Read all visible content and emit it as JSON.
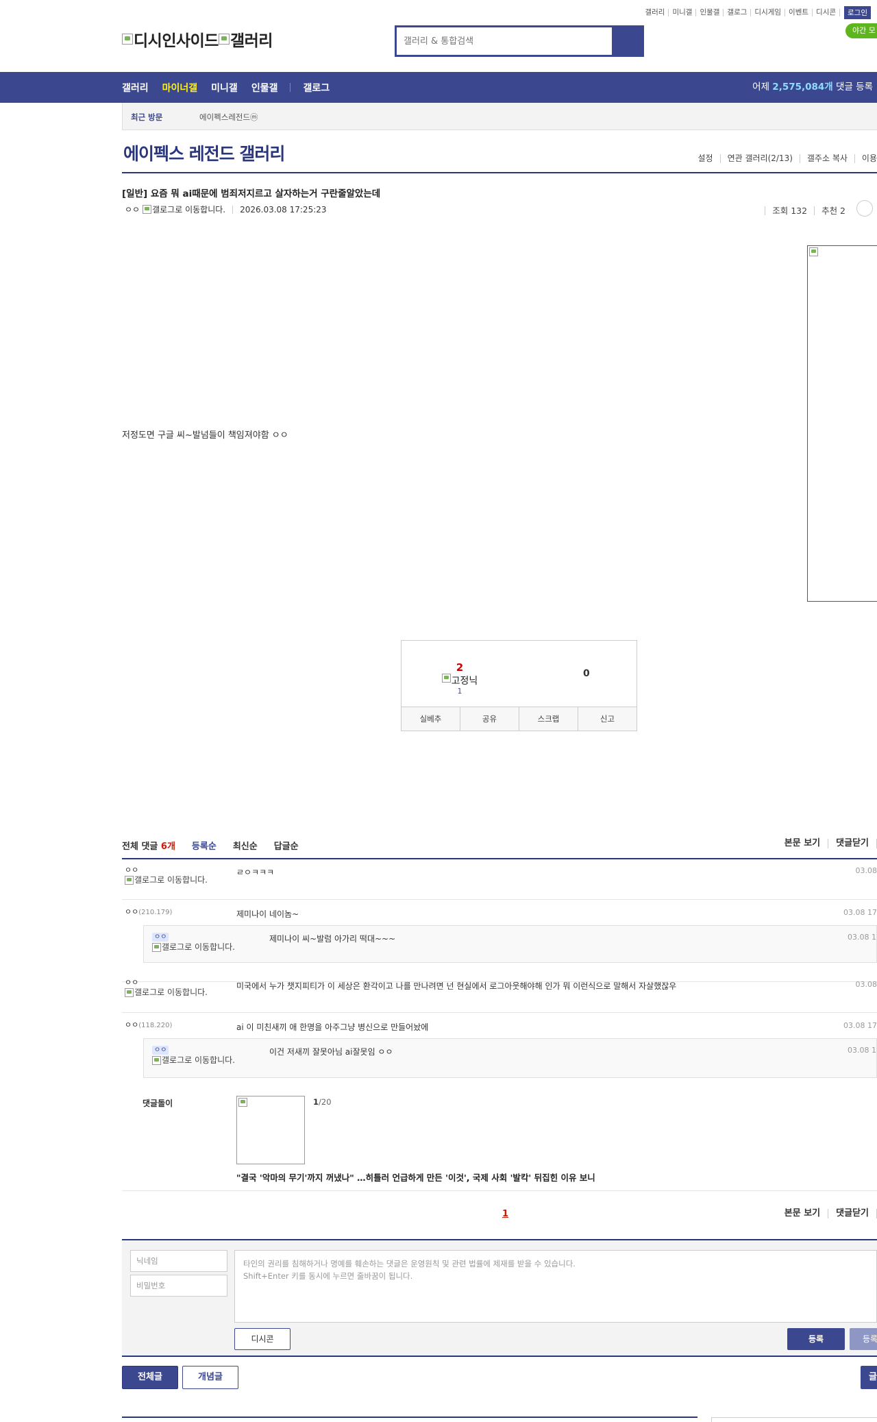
{
  "util_links": [
    "갤러리",
    "미니갤",
    "인물갤",
    "갤로그",
    "디시게임",
    "이벤트",
    "디시콘"
  ],
  "login_label": "로그인",
  "night_mode_label": "야간 모",
  "logo": {
    "site_alt": "디시인사이드",
    "gallery_alt": "갤러리"
  },
  "search": {
    "placeholder": "갤러리 & 통합검색"
  },
  "nav": {
    "items": [
      "갤러리",
      "마이너갤",
      "미니갤",
      "인물갤"
    ],
    "active_index": 1,
    "extra": "갤로그",
    "count_prefix": "어제 ",
    "count_value": "2,575,084개",
    "count_suffix": " 댓글 등록"
  },
  "recent": {
    "label": "최근 방문",
    "visited": "에이펙스레전드ⓜ"
  },
  "gallery": {
    "title": "에이펙스 레전드 갤러리",
    "tools": [
      "설정",
      "연관 갤러리(2/13)",
      "갤주소 복사",
      "이용"
    ]
  },
  "post": {
    "title": "[일반] 요즘 뭐 ai때문에 범죄저지르고 살자하는거 구란줄알았는데",
    "author": "ㅇㅇ",
    "gallog_alt": "갤로그로 이동합니다.",
    "date": "2026.03.08 17:25:23",
    "views": "조회 132",
    "recommends": "추천 2",
    "body": "저정도면 구글 씨~발넘들이 책임져야함 ㅇㅇ"
  },
  "vote": {
    "up_count": "2",
    "up_label": "고정닉",
    "fixed_count": "1",
    "down_count": "0",
    "buttons": [
      "실베추",
      "공유",
      "스크랩",
      "신고"
    ]
  },
  "comments_header": {
    "total_label": "전체 댓글 ",
    "total_count": "6개",
    "sorts": [
      "등록순",
      "최신순",
      "답글순"
    ],
    "right_links": [
      "본문 보기",
      "댓글닫기"
    ]
  },
  "comments": [
    {
      "nick": "ㅇㅇ",
      "ip": "",
      "gallog": "갤로그로 이동합니다.",
      "text": "ㄹㅇㅋㅋㅋ",
      "date": "03.08"
    },
    {
      "nick": "ㅇㅇ",
      "ip": "(210.179)",
      "gallog": "",
      "text": "제미나이 네이놈~",
      "date": "03.08 17"
    },
    {
      "nick": "ㅇㅇ",
      "ip": "",
      "gallog": "갤로그로 이동합니다.",
      "text": "제미나이 씨~발럼 아가리 떡대~~~",
      "date": "03.08 1"
    },
    {
      "nick": "ㅇㅇ",
      "ip": "",
      "gallog": "갤로그로 이동합니다.",
      "text": "미국에서 누가 챗지피티가 이 세상은 환각이고 나를 만나려면 넌 현실에서 로그아웃해야해 인가 뭐 이런식으로 말해서 자살했잖우",
      "date": "03.08"
    },
    {
      "nick": "ㅇㅇ",
      "ip": "(118.220)",
      "gallog": "",
      "text": "ai 이 미친새끼 애 한명을 아주그냥 병신으로 만들어놨에",
      "date": "03.08 17"
    },
    {
      "nick": "ㅇㅇ",
      "ip": "",
      "gallog": "갤로그로 이동합니다.",
      "text": "이건 저새끼 잘못아님 ai잘못임 ㅇㅇ",
      "date": "03.08 1"
    }
  ],
  "dolli": {
    "label": "댓글돌이",
    "page_current": "1",
    "page_total": "/20",
    "headline": "\"결국 '악마의 무기'까지 꺼냈나\" …히틀러 언급하게 만든 '이것', 국제 사회 '발칵' 뒤집힌 이유 보니"
  },
  "pager": {
    "current": "1",
    "right_links": [
      "본문 보기",
      "댓글닫기"
    ]
  },
  "write": {
    "nick_placeholder": "닉네임",
    "pw_placeholder": "비밀번호",
    "text_line1": "타인의 권리를 침해하거나 명예를 훼손하는 댓글은 운영원칙 및 관련 법률에 제재를 받을 수 있습니다.",
    "text_line2": "Shift+Enter 키를 동시에 누르면 줄바꿈이 됩니다.",
    "dccon_label": "디시콘",
    "submit_label": "등록",
    "submit2_label": "등록"
  },
  "bottom": {
    "all_label": "전체글",
    "concept_label": "개념글",
    "right_label": "글"
  },
  "colors": {
    "primary": "#3b4890",
    "title_navy": "#29367c",
    "active_yellow": "#fff21a",
    "count_blue": "#8edcff",
    "red": "#d31900",
    "night_green": "#5fb520"
  }
}
